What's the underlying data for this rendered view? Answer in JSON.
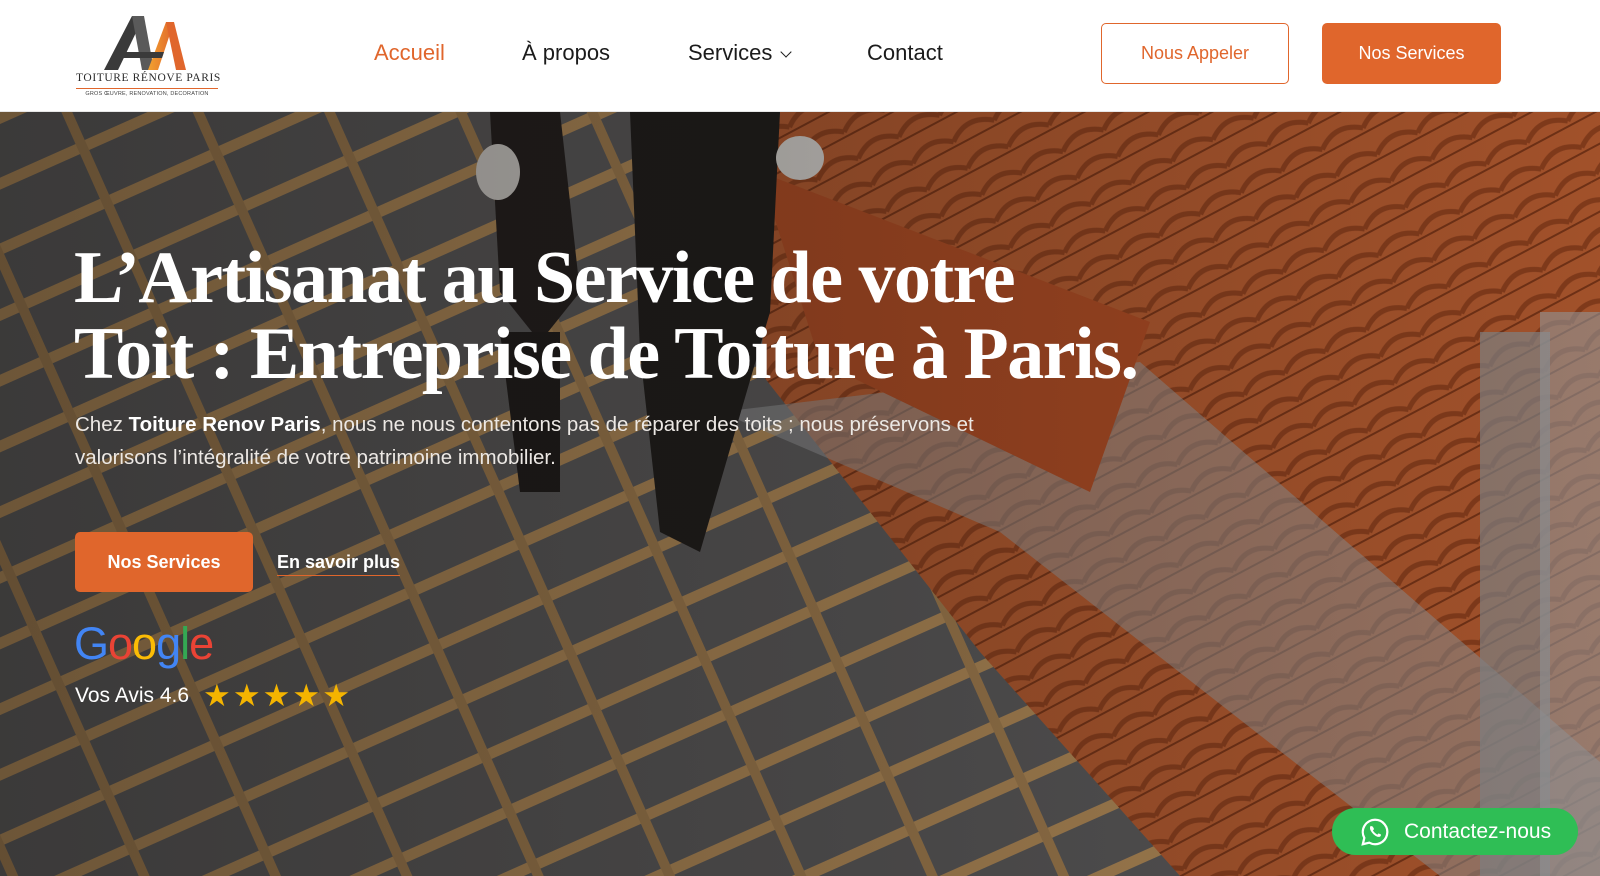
{
  "logo": {
    "name": "TOITURE RÉNOVE PARIS",
    "tagline": "GROS ŒUVRE, RENOVATION, DECORATION"
  },
  "nav": {
    "items": [
      {
        "label": "Accueil",
        "active": true
      },
      {
        "label": "À propos",
        "active": false
      },
      {
        "label": "Services",
        "active": false,
        "dropdown": true
      },
      {
        "label": "Contact",
        "active": false
      }
    ]
  },
  "header": {
    "call_button": "Nous Appeler",
    "services_button": "Nos Services"
  },
  "hero": {
    "title_line1": "L’Artisanat au Service de votre",
    "title_line2": "Toit : Entreprise de Toiture à Paris.",
    "desc_prefix": "Chez ",
    "desc_brand": "Toiture Renov Paris",
    "desc_rest": ", nous ne nous contentons pas de réparer des toits ; nous préservons et valorisons l’intégralité de votre patrimoine immobilier.",
    "primary_button": "Nos Services",
    "secondary_link": "En savoir plus"
  },
  "reviews": {
    "provider": "Google",
    "label": "Vos Avis 4.6",
    "stars_shown": 5
  },
  "whatsapp": {
    "label": "Contactez-nous"
  },
  "colors": {
    "accent": "#e0662c",
    "whatsapp": "#2fbe55",
    "star": "#f4b400"
  }
}
